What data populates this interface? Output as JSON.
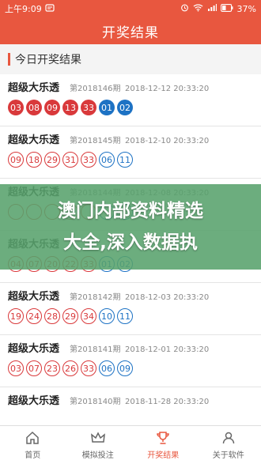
{
  "status": {
    "time": "上午9:09",
    "battery": "37%"
  },
  "header": {
    "title": "开奖结果"
  },
  "section": {
    "title": "今日开奖结果"
  },
  "results": [
    {
      "name": "超级大乐透",
      "issue": "第2018146期",
      "time": "2018-12-12 20:33:20",
      "front": [
        "03",
        "08",
        "09",
        "13",
        "33"
      ],
      "back": [
        "01",
        "02"
      ],
      "filled": true
    },
    {
      "name": "超级大乐透",
      "issue": "第2018145期",
      "time": "2018-12-10 20:33:20",
      "front": [
        "09",
        "18",
        "29",
        "31",
        "33"
      ],
      "back": [
        "06",
        "11"
      ],
      "filled": false
    },
    {
      "name": "超级大乐透",
      "issue": "第2018144期",
      "time": "2018-12-08 20:33:20",
      "front": [
        "",
        "",
        "",
        "",
        ""
      ],
      "back": [
        "",
        ""
      ],
      "filled": false
    },
    {
      "name": "超级大乐透",
      "issue": "",
      "time": "",
      "front": [
        "04",
        "07",
        "20",
        "22",
        "33"
      ],
      "back": [
        "01",
        "02"
      ],
      "filled": false
    },
    {
      "name": "超级大乐透",
      "issue": "第2018142期",
      "time": "2018-12-03 20:33:20",
      "front": [
        "19",
        "24",
        "28",
        "29",
        "34"
      ],
      "back": [
        "10",
        "11"
      ],
      "filled": false
    },
    {
      "name": "超级大乐透",
      "issue": "第2018141期",
      "time": "2018-12-01 20:33:20",
      "front": [
        "03",
        "07",
        "23",
        "26",
        "33"
      ],
      "back": [
        "06",
        "09"
      ],
      "filled": false
    },
    {
      "name": "超级大乐透",
      "issue": "第2018140期",
      "time": "2018-11-28 20:33:20",
      "front": [],
      "back": [],
      "filled": false
    }
  ],
  "overlay": {
    "line1": "澳门内部资料精选",
    "line2": "大全,深入数据执"
  },
  "tabs": [
    {
      "label": "首页",
      "icon": "home-icon"
    },
    {
      "label": "模拟投注",
      "icon": "crown-icon"
    },
    {
      "label": "开奖结果",
      "icon": "trophy-icon",
      "active": true
    },
    {
      "label": "关于软件",
      "icon": "user-icon"
    }
  ],
  "colors": {
    "accent": "#e8573f",
    "red": "#d9393b",
    "blue": "#1d72c4"
  }
}
